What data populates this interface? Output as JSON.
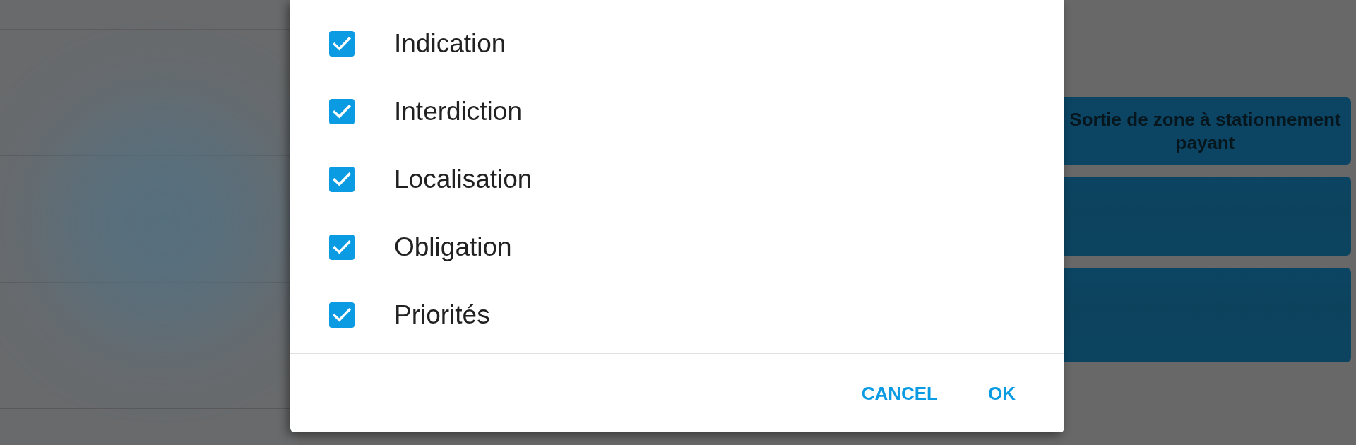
{
  "dialog": {
    "options": [
      {
        "label": "Indication",
        "checked": true
      },
      {
        "label": "Interdiction",
        "checked": true
      },
      {
        "label": "Localisation",
        "checked": true
      },
      {
        "label": "Obligation",
        "checked": true
      },
      {
        "label": "Priorités",
        "checked": true
      }
    ],
    "buttons": [
      {
        "label": "CANCEL"
      },
      {
        "label": "OK"
      }
    ]
  },
  "background_tiles": [
    {
      "kind": "text",
      "label": "Sortie de zone à stationnement payant"
    },
    {
      "kind": "blurred"
    },
    {
      "kind": "blurred"
    }
  ]
}
